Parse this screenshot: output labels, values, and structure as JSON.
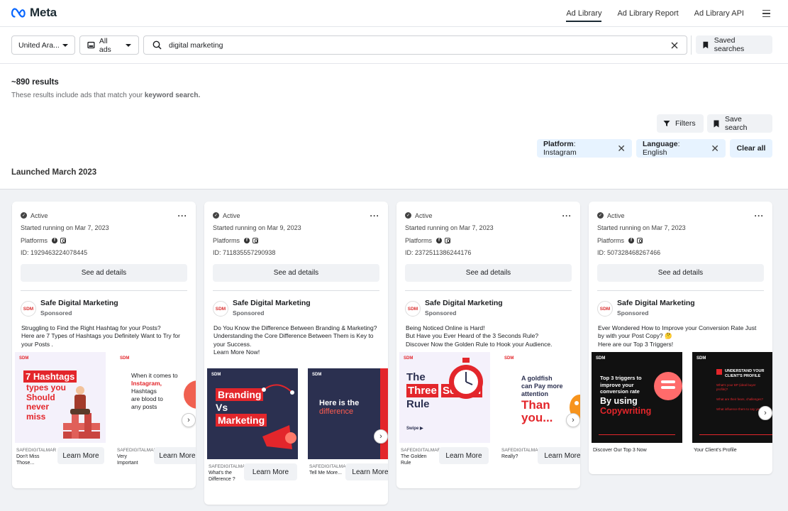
{
  "brand": {
    "logo_text": "Meta"
  },
  "nav": {
    "ad_library": "Ad Library",
    "ad_library_report": "Ad Library Report",
    "ad_library_api": "Ad Library API"
  },
  "search": {
    "country": "United Ara...",
    "ad_type": "All ads",
    "query": "digital marketing",
    "saved_searches": "Saved searches"
  },
  "results": {
    "count": "~890 results",
    "note_prefix": "These results include ads that match your ",
    "note_bold": "keyword search."
  },
  "actions": {
    "filters": "Filters",
    "save_search": "Save search"
  },
  "chips": [
    {
      "key": "Platform",
      "value": ": Instagram"
    },
    {
      "key": "Language",
      "value": ": English"
    }
  ],
  "clear_all": "Clear all",
  "section_title": "Launched March 2023",
  "cards": [
    {
      "status": "Active",
      "started": "Started running on Mar 7, 2023",
      "platforms_label": "Platforms",
      "id": "ID: 1929463224078445",
      "see_details": "See ad details",
      "advertiser": "Safe Digital Marketing",
      "sponsored": "Sponsored",
      "adv_logo": "SDM",
      "body": [
        "Struggling to Find the Right Hashtag for your Posts?",
        "Here are 7 Types of Hashtags you Definitely Want to Try for your Posts ."
      ],
      "slides": [
        {
          "logo": "SDM",
          "headline": [
            "7 Hashtags",
            "types you",
            "Should",
            "never",
            "miss"
          ],
          "domain": "SAFEDIGITALMAR",
          "caption": [
            "Don't Miss",
            "Those..."
          ],
          "cta": "Learn More"
        },
        {
          "logo": "SDM",
          "headline": [
            "When it comes to",
            "Instagram,",
            "Hashtags",
            "are blood to",
            "any posts"
          ],
          "domain": "SAFEDIGITALMAR",
          "caption": [
            "Very",
            "Important"
          ],
          "cta": "Learn More"
        }
      ]
    },
    {
      "status": "Active",
      "started": "Started running on Mar 9, 2023",
      "platforms_label": "Platforms",
      "id": "ID: 711835557290938",
      "see_details": "See ad details",
      "advertiser": "Safe Digital Marketing",
      "sponsored": "Sponsored",
      "adv_logo": "SDM",
      "body": [
        "Do You Know the Difference Between Branding & Marketing?",
        "Understanding the Core Difference Between Them is Key to your Success.",
        "Learn More Now!"
      ],
      "slides": [
        {
          "logo": "SDM",
          "headline": [
            "Branding",
            "Vs",
            "Marketing"
          ],
          "domain": "SAFEDIGITALMAR",
          "caption": [
            "What's the",
            "Difference ?"
          ],
          "cta": "Learn More"
        },
        {
          "logo": "SDM",
          "headline": [
            "Here is the",
            "difference"
          ],
          "domain": "SAFEDIGITALMAR",
          "caption": [
            "Tell Me More..."
          ],
          "cta": "Learn More"
        }
      ]
    },
    {
      "status": "Active",
      "started": "Started running on Mar 7, 2023",
      "platforms_label": "Platforms",
      "id": "ID: 2372511386244176",
      "see_details": "See ad details",
      "advertiser": "Safe Digital Marketing",
      "sponsored": "Sponsored",
      "adv_logo": "SDM",
      "body": [
        "Being Noticed Online is Hard!",
        "But Have you Ever Heard of the 3 Seconds Rule?",
        "Discover Now the Golden Rule to Hook your Audience."
      ],
      "slides": [
        {
          "logo": "SDM",
          "headline": [
            "The",
            "Three",
            "Second",
            "Rule"
          ],
          "swipe": "Swipe ▶",
          "domain": "SAFEDIGITALMAR",
          "caption": [
            "The Golden",
            "Rule"
          ],
          "cta": "Learn More"
        },
        {
          "logo": "SDM",
          "headline": [
            "A goldfish",
            "can Pay more",
            "attention",
            "Than",
            "you..."
          ],
          "domain": "SAFEDIGITALMAR",
          "caption": [
            "Really?"
          ],
          "cta": "Learn More"
        }
      ]
    },
    {
      "status": "Active",
      "started": "Started running on Mar 7, 2023",
      "platforms_label": "Platforms",
      "id": "ID: 507328468267466",
      "see_details": "See ad details",
      "advertiser": "Safe Digital Marketing",
      "sponsored": "Sponsored",
      "adv_logo": "SDM",
      "body": [
        "Ever Wondered How to Improve your Conversion Rate Just by with your Post Copy? 🤔",
        "Here are our Top 3 Triggers!"
      ],
      "slides": [
        {
          "logo": "SDM",
          "headline": [
            "Top 3 triggers to",
            "improve your",
            "conversion rate",
            "By using",
            "Copywriting"
          ],
          "caption": [
            "Discover Our Top 3 Now"
          ]
        },
        {
          "logo": "SDM",
          "headline": [
            "UNDERSTAND YOUR",
            "CLIENT'S PROFILE",
            "What's your BP (ideal buyer profile)?",
            "What are their fears, challenges?",
            "What influence them to say yes?"
          ],
          "caption": [
            "Your Client's Profile"
          ]
        }
      ]
    }
  ],
  "colors": {
    "accent_red": "#e3262b",
    "navy": "#2b3050",
    "chip_bg": "#e7f3ff"
  }
}
